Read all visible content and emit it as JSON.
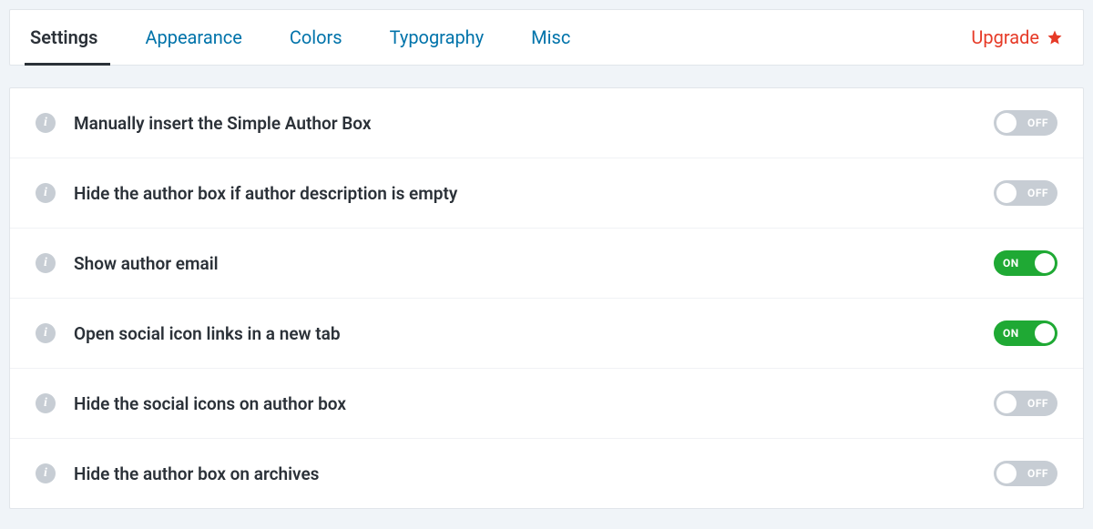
{
  "tabs": {
    "items": [
      {
        "label": "Settings",
        "active": true
      },
      {
        "label": "Appearance",
        "active": false
      },
      {
        "label": "Colors",
        "active": false
      },
      {
        "label": "Typography",
        "active": false
      },
      {
        "label": "Misc",
        "active": false
      }
    ],
    "upgrade_label": "Upgrade"
  },
  "toggle_labels": {
    "on": "ON",
    "off": "OFF"
  },
  "settings": {
    "rows": [
      {
        "label": "Manually insert the Simple Author Box",
        "value": false
      },
      {
        "label": "Hide the author box if author description is empty",
        "value": false
      },
      {
        "label": "Show author email",
        "value": true
      },
      {
        "label": "Open social icon links in a new tab",
        "value": true
      },
      {
        "label": "Hide the social icons on author box",
        "value": false
      },
      {
        "label": "Hide the author box on archives",
        "value": false
      }
    ]
  },
  "colors": {
    "link": "#0073aa",
    "text": "#2b3138",
    "accent_danger": "#e63a27",
    "toggle_on": "#1fa934",
    "toggle_off": "#c7cdd4"
  }
}
